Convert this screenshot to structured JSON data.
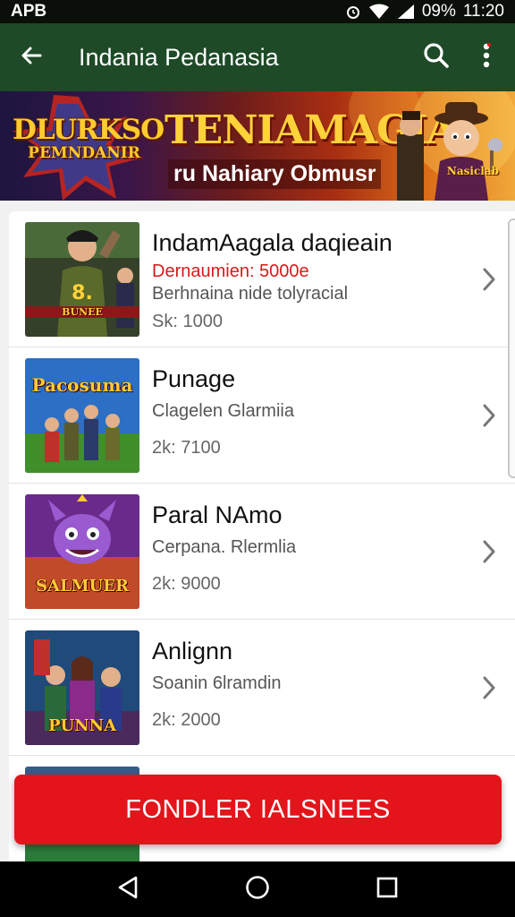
{
  "status_bar": {
    "carrier": "APB",
    "battery": "09%",
    "time": "11:20"
  },
  "app_bar": {
    "title": "Indania Pedanasia"
  },
  "banner": {
    "logo_main": "DLURKSO",
    "logo_sub": "PEMNDANIR",
    "headline": "TENIAMAGIA",
    "subline": "ru Nahiary Obmusr",
    "mascot_label": "Nasiclab"
  },
  "items": [
    {
      "name": "IndamAagala daqieain",
      "promo": "Dernaumien: 5000e",
      "desc": "Berhnaina nide tolyracial",
      "price": "Sk: 1000",
      "thumb_label": "BUNEE"
    },
    {
      "name": "Punage",
      "desc": "Clagelen Glarmiia",
      "price": "2k: 7100",
      "thumb_label": "Pacosuma"
    },
    {
      "name": "Paral NAmo",
      "desc": "Cerpana. Rlermlia",
      "price": "2k: 9000",
      "thumb_label": "SALMUER"
    },
    {
      "name": "Anlignn",
      "desc": "Soanin 6lramdin",
      "price": "2k: 2000",
      "thumb_label": "PUNNA"
    }
  ],
  "cta": {
    "label": "FONDLER IALSNEES"
  },
  "colors": {
    "app_bar": "#1e4a27",
    "accent_red": "#e3141a",
    "promo_red": "#d71a1a"
  },
  "icons": [
    "back-arrow-icon",
    "search-icon",
    "more-vert-icon",
    "chevron-right-icon",
    "nav-back-icon",
    "nav-home-icon",
    "nav-recents-icon"
  ]
}
